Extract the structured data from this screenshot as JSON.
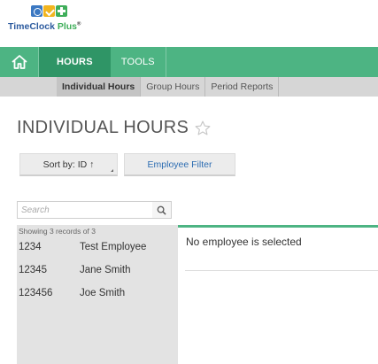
{
  "logo": {
    "text_time": "TimeClock",
    "text_plus": "Plus",
    "registered": "®"
  },
  "navbar": {
    "tabs": [
      {
        "label": "HOURS",
        "active": true
      },
      {
        "label": "TOOLS",
        "active": false
      }
    ]
  },
  "subnav": {
    "tabs": [
      {
        "label": "Individual Hours",
        "active": true
      },
      {
        "label": "Group Hours",
        "active": false
      },
      {
        "label": "Period Reports",
        "active": false
      }
    ]
  },
  "page": {
    "title": "INDIVIDUAL HOURS"
  },
  "toolbar": {
    "sort_label": "Sort by: ID ↑",
    "filter_label": "Employee Filter"
  },
  "search": {
    "placeholder": "Search"
  },
  "employees": {
    "showing": "Showing 3 records of 3",
    "rows": [
      {
        "id": "1234",
        "name": "Test Employee"
      },
      {
        "id": "12345",
        "name": "Jane Smith"
      },
      {
        "id": "123456",
        "name": "Joe Smith"
      }
    ]
  },
  "detail": {
    "empty_message": "No employee is selected"
  },
  "colors": {
    "accent_green": "#4db483",
    "active_tab": "#2f9566",
    "link_blue": "#2d6db2"
  }
}
